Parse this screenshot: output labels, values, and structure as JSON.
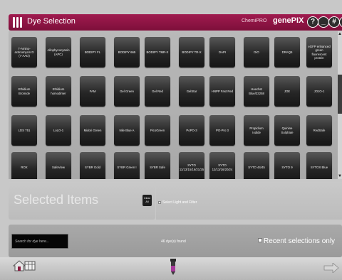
{
  "window": {
    "title": "Dye Selection",
    "brand_small": "ChemiPRO",
    "brand_big": "genePIX",
    "buttons": [
      "?",
      "_",
      "#",
      "X"
    ]
  },
  "dyes": [
    "7-Amino-actinomycin D (7-AAD)",
    "Allophycocyanin (APC)",
    "BODIPY FL",
    "BODIPY 665",
    "BODIPY TMR-X",
    "BODIPY TR-X",
    "DAPI",
    "DiO",
    "DRAQ5",
    "eGFP enhanced green fluorescent protein",
    "Ethidium Bromide",
    "Ethidium homodimer",
    "FAM",
    "Gel Green",
    "Gel Red",
    "GelStar",
    "HNPP Fast Red",
    "Hoechst Blue/33258",
    "JOE",
    "JOJO-1",
    "LDS 751",
    "LoLO-1",
    "Midori Green",
    "Nile Blue A",
    "PicoGreen",
    "PoPO-3",
    "PO-Pro 3",
    "Propidium Iodide",
    "Quinine Sulphate",
    "RedSafe",
    "ROX",
    "SafeView",
    "SYBR Gold",
    "SYBR Green I",
    "SYBR Safe",
    "SYTO 11/13/15/16/21/25",
    "SYTO 12/13/16/20/24",
    "SYTO 44/45",
    "SYTO 9",
    "SYTOX Blue"
  ],
  "scroll": {
    "up": "▲",
    "down": "▼"
  },
  "selected": {
    "title": "Selected Items",
    "clear_label": "Clear All"
  },
  "filter": {
    "label": "Select Light and Filter",
    "checked": false
  },
  "search": {
    "placeholder": "Search for dye here...",
    "value": "",
    "found_text": "46 dye(s) found",
    "recent_label": "Recent selections only",
    "recent_checked": false
  },
  "footer": {
    "icons": [
      "home-icon",
      "tube-icon",
      "next-icon"
    ]
  },
  "colors": {
    "titlebar": "#8e1545",
    "dye_button": "#262626",
    "panel": "#b5b5b5"
  }
}
